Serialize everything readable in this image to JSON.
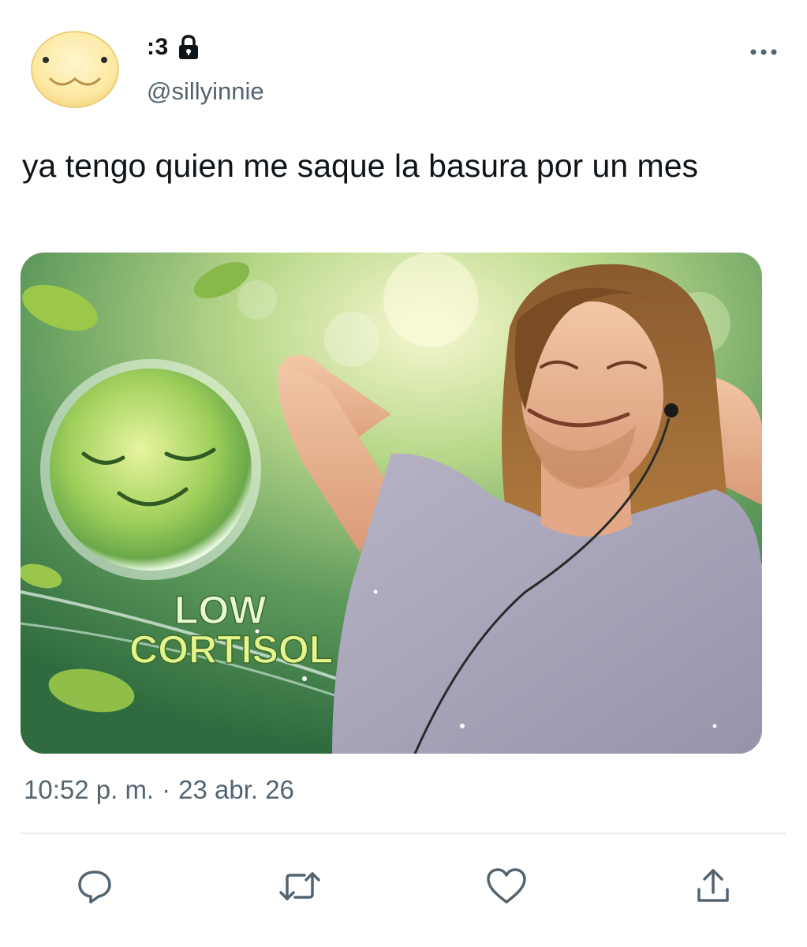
{
  "author": {
    "display_name": ":3",
    "handle": "@sillyinnie",
    "avatar_icon": "smiling-blob-avatar",
    "protected_icon": "lock-icon"
  },
  "tweet": {
    "text": "ya tengo quien me saque la basura por un mes",
    "media": {
      "overlay_text_line1": "LOW",
      "overlay_text_line2": "CORTISOL"
    },
    "time": "10:52 p. m.",
    "separator": "·",
    "date": "23 abr. 26"
  },
  "actions": [
    {
      "icon": "reply-icon"
    },
    {
      "icon": "retweet-icon"
    },
    {
      "icon": "like-icon"
    },
    {
      "icon": "share-icon"
    }
  ],
  "colors": {
    "text": "#0f1419",
    "secondary": "#536471",
    "divider": "#e6ecf0",
    "avatar_fill": "#fde9a3"
  }
}
